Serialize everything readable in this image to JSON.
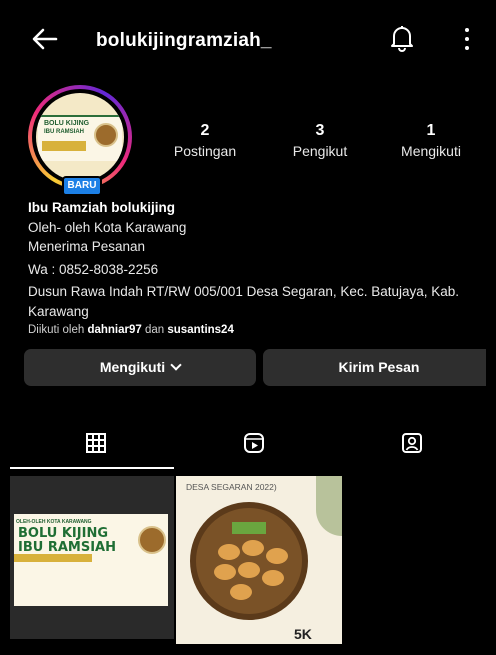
{
  "header": {
    "username": "bolukijingramziah_"
  },
  "profile": {
    "badge": "BARU",
    "avatar_text": [
      "BOLU KIJING",
      "IBU RAMSIAH"
    ]
  },
  "stats": [
    {
      "value": "2",
      "label": "Postingan"
    },
    {
      "value": "3",
      "label": "Pengikut"
    },
    {
      "value": "1",
      "label": "Mengikuti"
    }
  ],
  "bio": {
    "name": "Ibu Ramziah bolukijing",
    "lines": [
      "Oleh- oleh Kota Karawang",
      "Menerima Pesanan",
      "Wa : 0852-8038-2256",
      "Dusun Rawa Indah RT/RW 005/001 Desa Segaran, Kec. Batujaya, Kab.",
      "Karawang"
    ],
    "followed_prefix": "Diikuti oleh",
    "followed_user1": "dahniar97",
    "followed_and": "dan",
    "followed_user2": "susantins24"
  },
  "buttons": {
    "following": "Mengikuti",
    "message": "Kirim Pesan"
  },
  "tabs": [
    {
      "icon": "grid-icon",
      "active": true
    },
    {
      "icon": "reels-icon",
      "active": false
    },
    {
      "icon": "tagged-icon",
      "active": false
    }
  ],
  "posts": [
    {
      "top_text": "OLEH-OLEH KOTA KARAWANG",
      "title1": "BOLU KIJING",
      "title2": "IBU RAMSIAH"
    },
    {
      "top_text": "DESA SEGARAN 2022)",
      "big_text": "5K"
    }
  ],
  "colors": {
    "background": "#000000",
    "button": "#2e2e2e",
    "badge": "#1c80e6"
  }
}
